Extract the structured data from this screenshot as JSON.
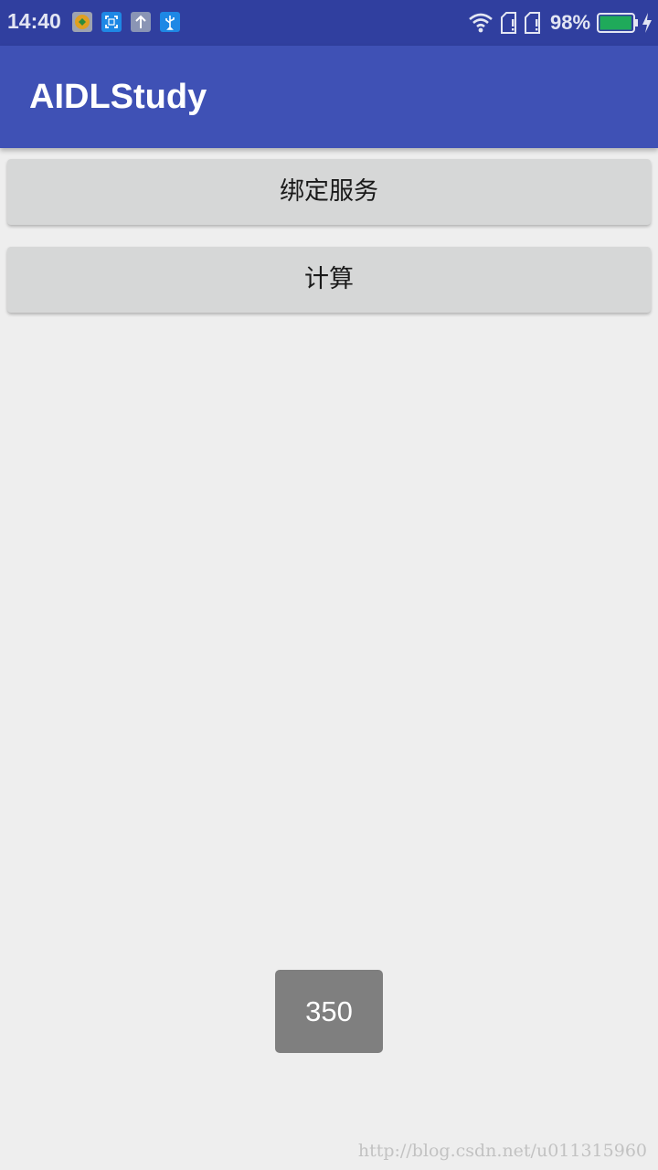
{
  "status_bar": {
    "time": "14:40",
    "battery_percent": "98%",
    "battery_level": 0.98,
    "icons_left": [
      "app-notification-icon",
      "screenshot-icon",
      "upload-icon",
      "usb-icon"
    ],
    "icons_right": [
      "wifi-icon",
      "sim-card-icon",
      "sim-card-icon",
      "battery-icon",
      "charging-icon"
    ]
  },
  "app_bar": {
    "title": "AIDLStudy"
  },
  "buttons": {
    "bind_service": "绑定服务",
    "calculate": "计算"
  },
  "toast": {
    "text": "350"
  },
  "watermark": {
    "text": "http://blog.csdn.net/u011315960"
  },
  "colors": {
    "status_bar": "#303f9f",
    "app_bar": "#3f51b5",
    "background": "#eeeeee",
    "button": "#d6d7d7",
    "toast": "#7f7f7f",
    "battery_fill": "#1faa5a"
  }
}
